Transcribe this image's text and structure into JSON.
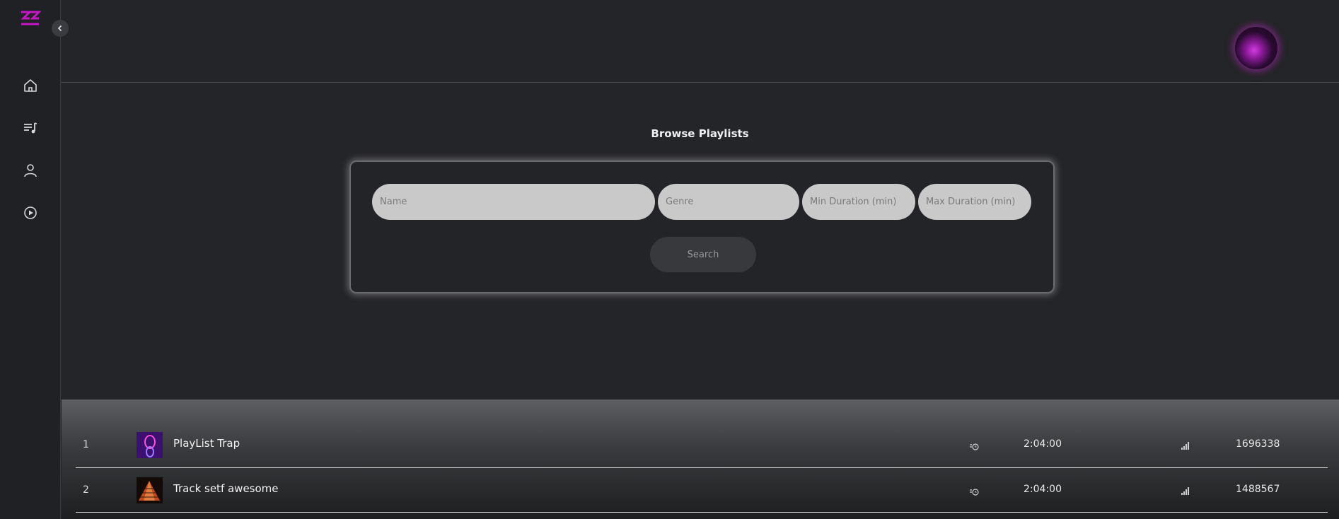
{
  "colors": {
    "brand": "#c616c6",
    "background": "#242528",
    "sidebar": "#202124",
    "input": "#c9c9c9"
  },
  "sidebar": {
    "logo": "zz-logo",
    "items": [
      {
        "icon": "home-icon",
        "label": "Home"
      },
      {
        "icon": "playlist-icon",
        "label": "Playlists"
      },
      {
        "icon": "user-icon",
        "label": "Profile"
      },
      {
        "icon": "play-circle-icon",
        "label": "Player"
      }
    ]
  },
  "header": {
    "avatar": "user-avatar"
  },
  "browse": {
    "title": "Browse Playlists",
    "name_placeholder": "Name",
    "genre_placeholder": "Genre",
    "min_placeholder": "Min Duration (min)",
    "max_placeholder": "Max Duration (min)",
    "search_label": "Search"
  },
  "results": [
    {
      "index": "1",
      "name": "PlayList Trap",
      "duration": "2:04:00",
      "plays": "1696338",
      "thumb": "neon-figure"
    },
    {
      "index": "2",
      "name": "Track setf awesome",
      "duration": "2:04:00",
      "plays": "1488567",
      "thumb": "pyramid"
    }
  ]
}
